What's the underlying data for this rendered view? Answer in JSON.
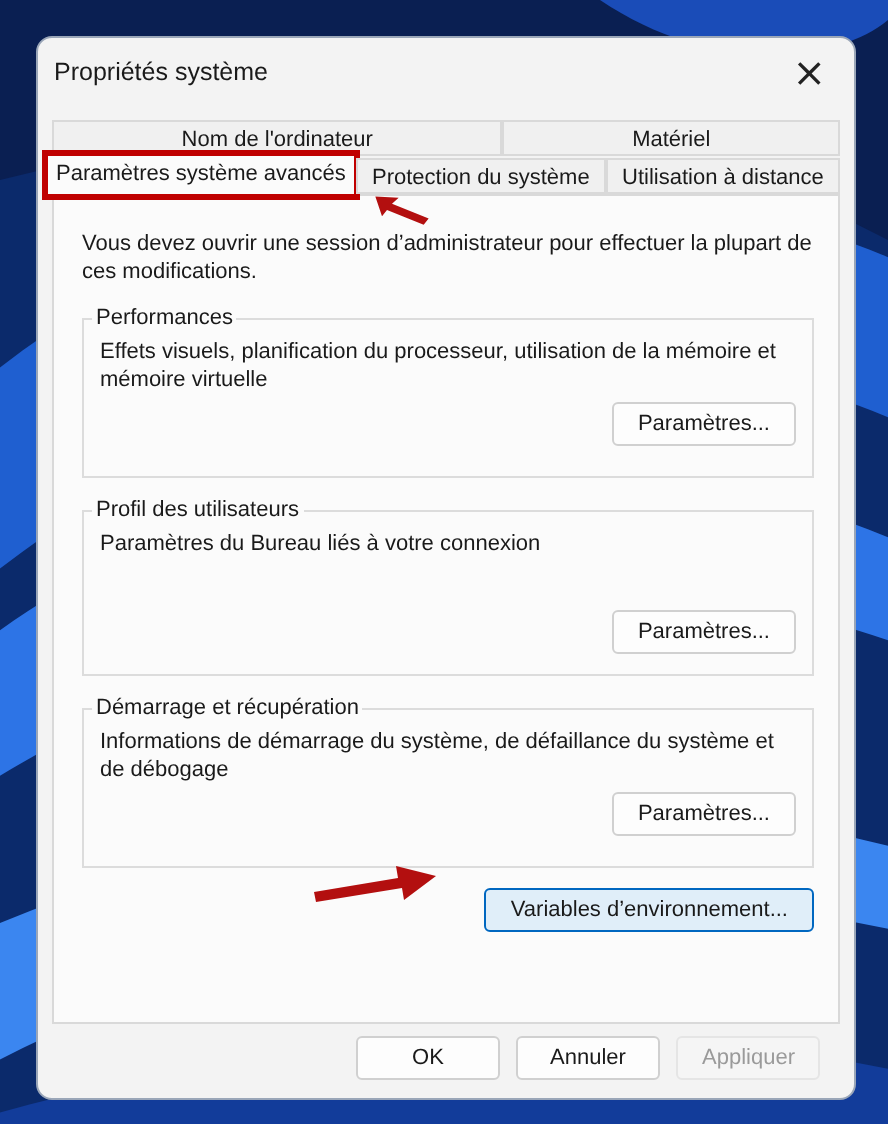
{
  "window": {
    "title": "Propriétés système",
    "close": "×"
  },
  "tab_rows": [
    {
      "tabs": [
        {
          "label": "Nom de l'ordinateur",
          "selected": false,
          "highlighted": false
        },
        {
          "label": "Matériel",
          "selected": false,
          "highlighted": false
        }
      ]
    },
    {
      "tabs": [
        {
          "label": "Paramètres système avancés",
          "selected": true,
          "highlighted": true
        },
        {
          "label": "Protection du système",
          "selected": false,
          "highlighted": false
        },
        {
          "label": "Utilisation à distance",
          "selected": false,
          "highlighted": false
        }
      ]
    }
  ],
  "notice": "Vous devez ouvrir une session d’administrateur pour effectuer la plupart de ces modifications.",
  "groups": [
    {
      "title": "Performances",
      "description": "Effets visuels, planification du processeur, utilisation de la mémoire et mémoire virtuelle",
      "button": "Paramètres..."
    },
    {
      "title": "Profil des utilisateurs",
      "description": "Paramètres du Bureau liés à votre connexion",
      "button": "Paramètres..."
    },
    {
      "title": "Démarrage et récupération",
      "description": "Informations de démarrage du système, de défaillance du système et de débogage",
      "button": "Paramètres..."
    }
  ],
  "env_button": {
    "label": "Variables d’environnement...",
    "focused": true
  },
  "footer_buttons": [
    {
      "label": "OK",
      "disabled": false
    },
    {
      "label": "Annuler",
      "disabled": false
    },
    {
      "label": "Appliquer",
      "disabled": true
    }
  ]
}
